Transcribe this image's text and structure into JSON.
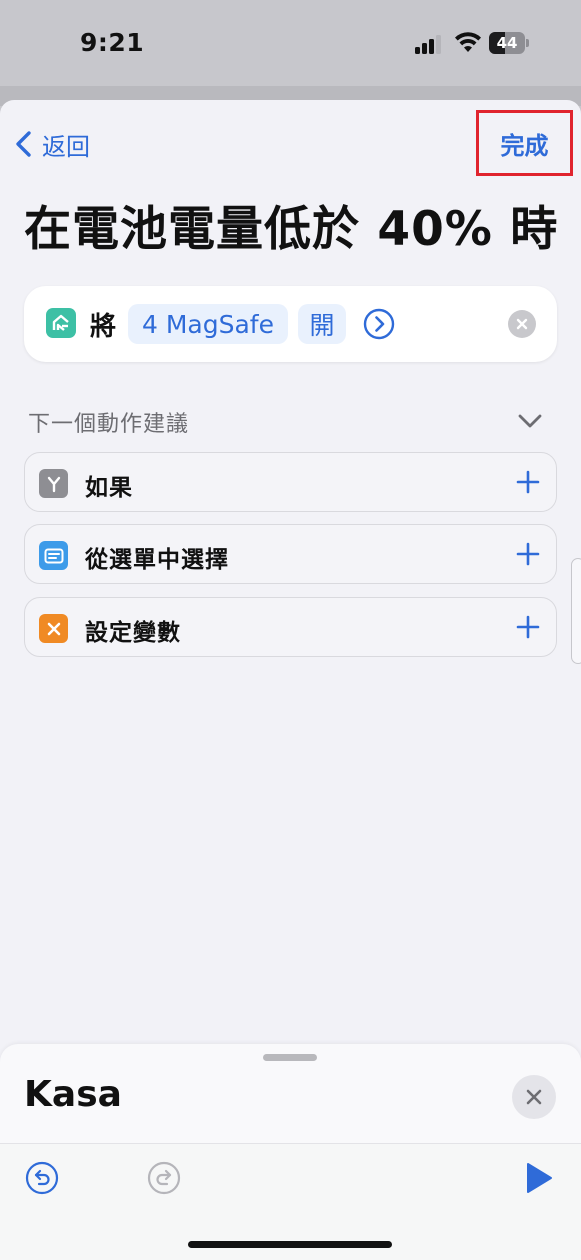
{
  "status_bar": {
    "time": "9:21",
    "battery_level": "44",
    "signal_bars": 3
  },
  "nav": {
    "back_label": "返回",
    "done_label": "完成"
  },
  "page": {
    "title": "在電池電量低於 40% 時"
  },
  "action": {
    "verb": "將",
    "device": "4 MagSafe",
    "state": "開",
    "app_icon": "kasa-app-icon"
  },
  "suggestions": {
    "header": "下一個動作建議",
    "items": [
      {
        "label": "如果",
        "icon": "branch-icon",
        "color": "#8e8e93"
      },
      {
        "label": "從選單中選擇",
        "icon": "menu-icon",
        "color": "#3d9be9"
      },
      {
        "label": "設定變數",
        "icon": "variable-icon",
        "color": "#f08a24"
      }
    ]
  },
  "panel": {
    "title": "Kasa"
  },
  "colors": {
    "accent": "#2f6bd8",
    "highlight_box": "#e0242e",
    "background": "#f2f2f7"
  }
}
